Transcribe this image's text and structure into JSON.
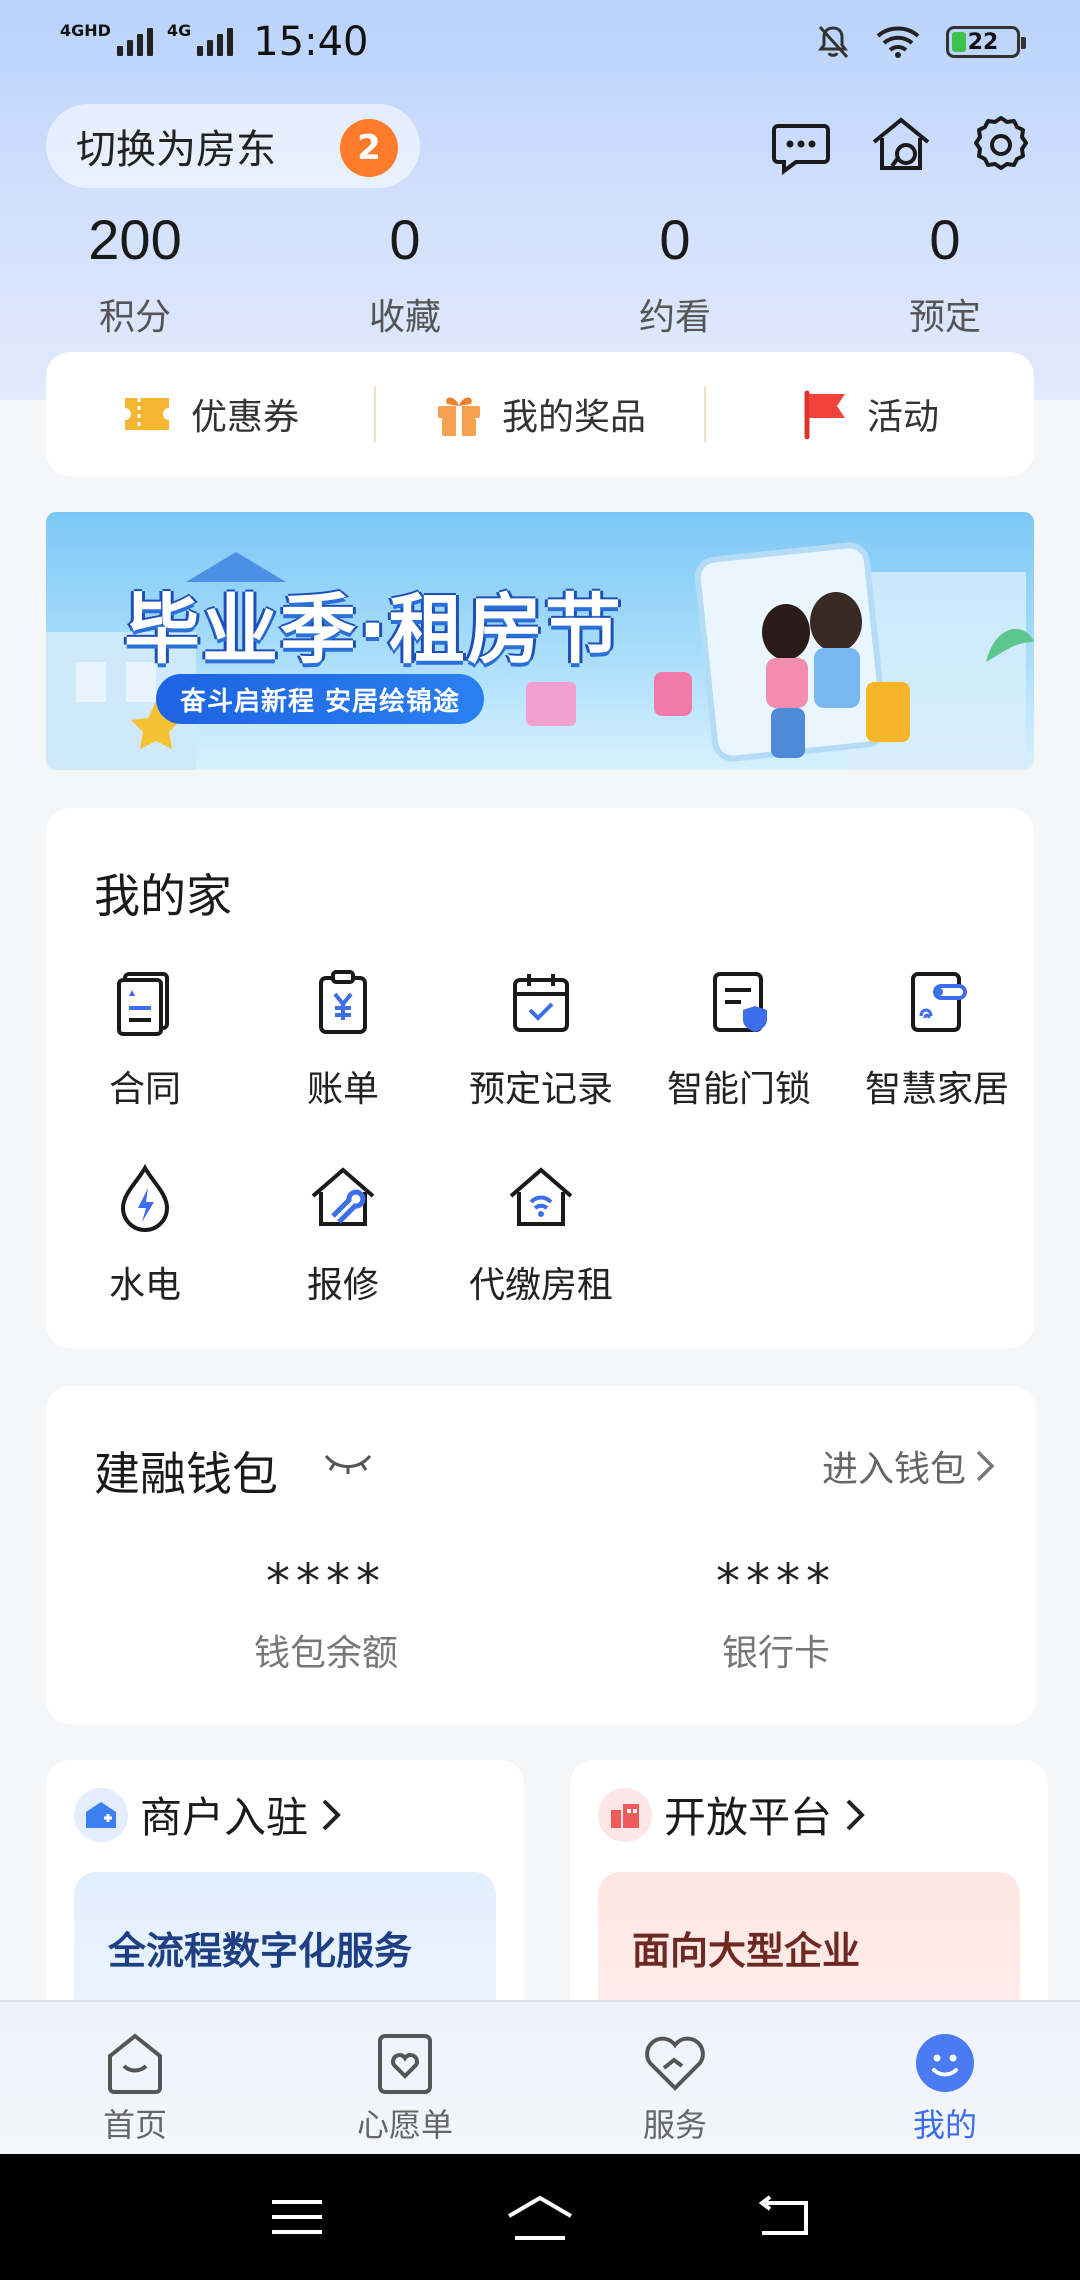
{
  "status": {
    "time": "15:40",
    "signal1": "4GHD",
    "signal2": "4G",
    "battery": "22"
  },
  "header": {
    "switch_label": "切换为房东",
    "switch_badge": "2"
  },
  "stats": [
    {
      "value": "200",
      "label": "积分"
    },
    {
      "value": "0",
      "label": "收藏"
    },
    {
      "value": "0",
      "label": "约看"
    },
    {
      "value": "0",
      "label": "预定"
    }
  ],
  "quick": [
    {
      "label": "优惠券",
      "icon": "coupon-icon"
    },
    {
      "label": "我的奖品",
      "icon": "gift-icon"
    },
    {
      "label": "活动",
      "icon": "flag-icon"
    }
  ],
  "banner": {
    "title": "毕业季·租房节",
    "subtitle": "奋斗启新程 安居绘锦途"
  },
  "home": {
    "title": "我的家",
    "items": [
      {
        "label": "合同",
        "icon": "contract-icon"
      },
      {
        "label": "账单",
        "icon": "bill-icon"
      },
      {
        "label": "预定记录",
        "icon": "calendar-icon"
      },
      {
        "label": "智能门锁",
        "icon": "smart-lock-icon"
      },
      {
        "label": "智慧家居",
        "icon": "smart-home-icon"
      },
      {
        "label": "水电",
        "icon": "utilities-icon"
      },
      {
        "label": "报修",
        "icon": "repair-icon"
      },
      {
        "label": "代缴房租",
        "icon": "rent-pay-icon"
      }
    ]
  },
  "wallet": {
    "title": "建融钱包",
    "enter": "进入钱包",
    "balance": {
      "value": "****",
      "label": "钱包余额"
    },
    "card": {
      "value": "****",
      "label": "银行卡"
    }
  },
  "merchant": {
    "title": "商户入驻",
    "desc": "全流程数字化服务"
  },
  "platform": {
    "title": "开放平台",
    "desc": "面向大型企业"
  },
  "tabs": [
    {
      "label": "首页",
      "icon": "home-tab-icon"
    },
    {
      "label": "心愿单",
      "icon": "wishlist-icon"
    },
    {
      "label": "服务",
      "icon": "service-icon"
    },
    {
      "label": "我的",
      "icon": "profile-icon"
    }
  ],
  "colors": {
    "accent": "#3b6ee8",
    "badge": "#ff7a2b",
    "coupon": "#f5b731",
    "flag": "#f0443a"
  }
}
